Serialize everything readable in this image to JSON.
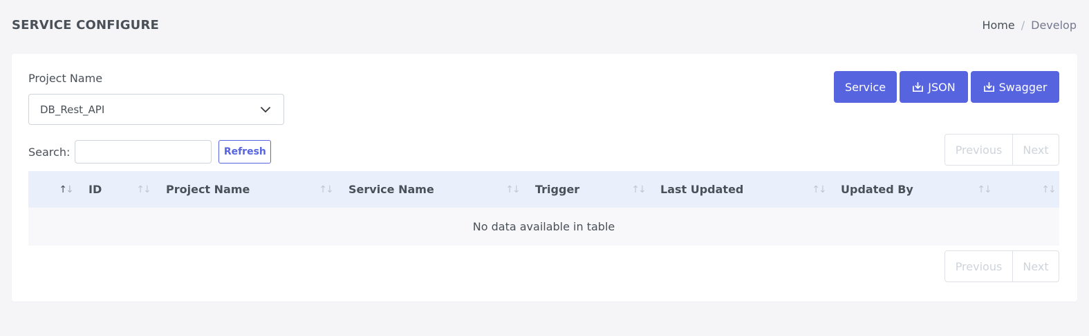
{
  "page": {
    "title": "SERVICE CONFIGURE",
    "breadcrumb": {
      "home": "Home",
      "separator": "/",
      "current": "Develop"
    }
  },
  "form": {
    "project_label": "Project Name",
    "project_selected": "DB_Rest_API",
    "search_label": "Search:",
    "search_value": "",
    "refresh_label": "Refresh"
  },
  "actions": {
    "service_label": "Service",
    "json_label": "JSON",
    "swagger_label": "Swagger"
  },
  "pagination": {
    "previous": "Previous",
    "next": "Next"
  },
  "table": {
    "columns": [
      "ID",
      "Project Name",
      "Service Name",
      "Trigger",
      "Last Updated",
      "Updated By"
    ],
    "empty_message": "No data available in table"
  },
  "colors": {
    "primary": "#5664e0",
    "table_header": "#eaeffc"
  }
}
